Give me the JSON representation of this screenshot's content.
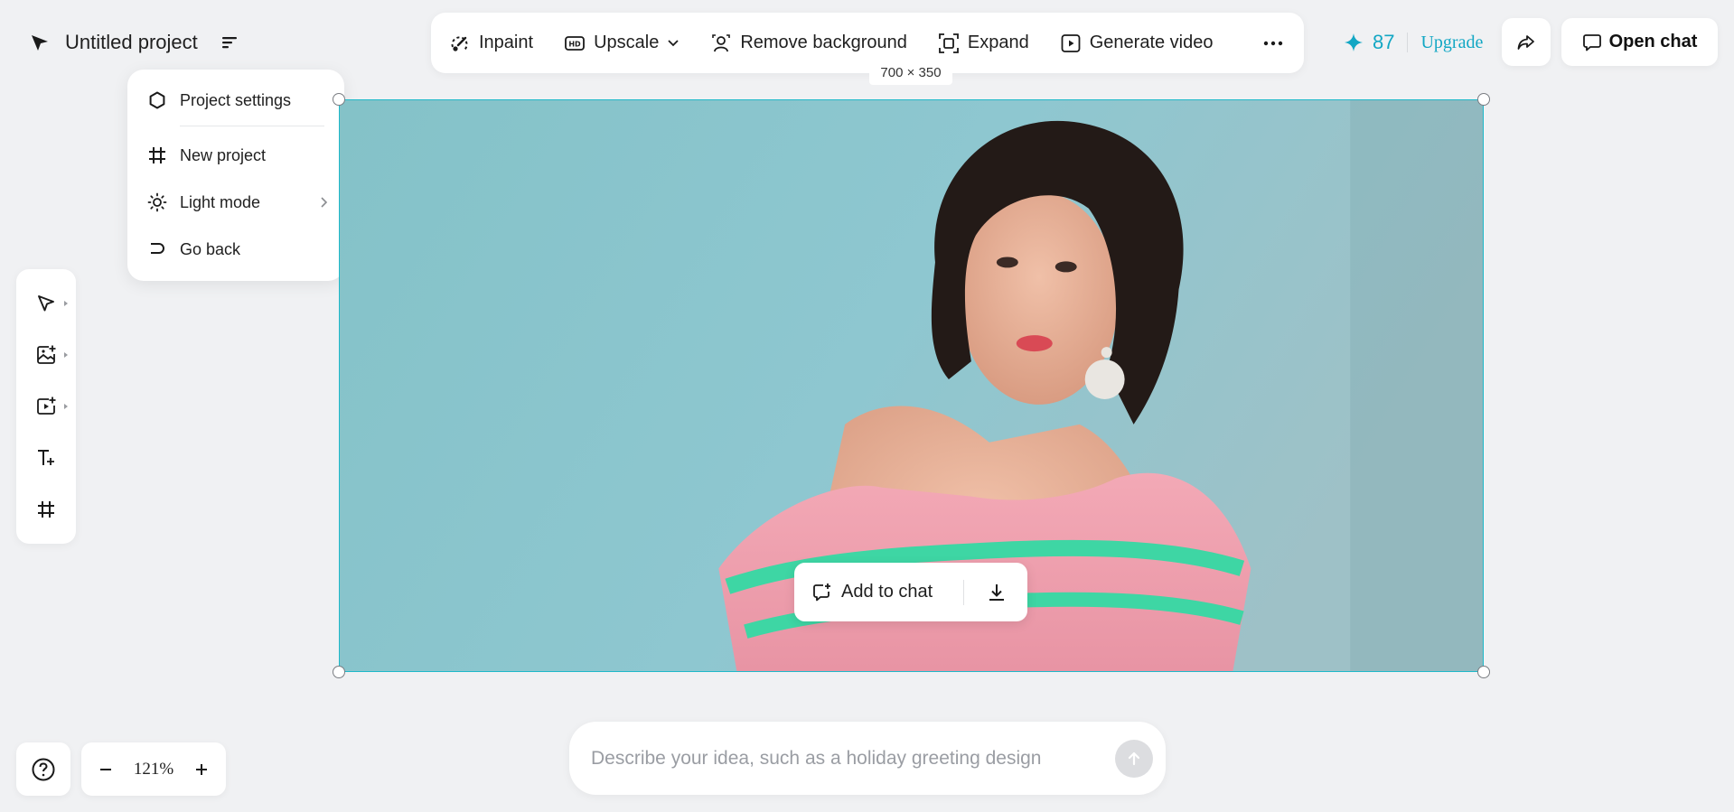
{
  "header": {
    "logo_icon": "arrow-logo-icon",
    "project_title": "Untitled project",
    "menu_icon": "menu-lines-icon"
  },
  "project_menu": {
    "items": [
      {
        "label": "Project settings",
        "icon": "settings-icon"
      },
      {
        "label": "New project",
        "icon": "frame-icon"
      },
      {
        "label": "Light mode",
        "icon": "sun-icon",
        "has_submenu": true
      },
      {
        "label": "Go back",
        "icon": "undo-arrow-icon"
      }
    ]
  },
  "toolbar": {
    "items": [
      {
        "label": "Inpaint",
        "icon": "brush-icon"
      },
      {
        "label": "Upscale",
        "icon": "hd-icon",
        "has_dropdown": true
      },
      {
        "label": "Remove background",
        "icon": "person-cutout-icon"
      },
      {
        "label": "Expand",
        "icon": "expand-icon"
      },
      {
        "label": "Generate video",
        "icon": "play-icon"
      }
    ],
    "more_icon": "more-horizontal-icon"
  },
  "credits": {
    "count": "87",
    "icon": "sparkle-icon",
    "upgrade_label": "Upgrade"
  },
  "share_icon": "share-arrow-icon",
  "open_chat": {
    "label": "Open chat",
    "icon": "chat-bubble-icon"
  },
  "tools": [
    {
      "name": "select",
      "icon": "pointer-icon"
    },
    {
      "name": "add-image",
      "icon": "image-plus-icon"
    },
    {
      "name": "add-video",
      "icon": "video-plus-icon"
    },
    {
      "name": "add-text",
      "icon": "text-plus-icon"
    },
    {
      "name": "frame",
      "icon": "frame-icon"
    }
  ],
  "canvas": {
    "dimension_label": "700 × 350",
    "image_alt": "Portrait of a woman in pink striped off-shoulder sweater on teal background"
  },
  "image_actions": {
    "add_to_chat_label": "Add to chat",
    "add_icon": "chat-add-icon",
    "download_icon": "download-icon"
  },
  "zoom": {
    "value": "121%"
  },
  "prompt": {
    "placeholder": "Describe your idea, such as a holiday greeting design",
    "value": ""
  },
  "colors": {
    "accent": "#12a7c4",
    "selection": "#1fb9c9",
    "background": "#f0f1f3"
  }
}
